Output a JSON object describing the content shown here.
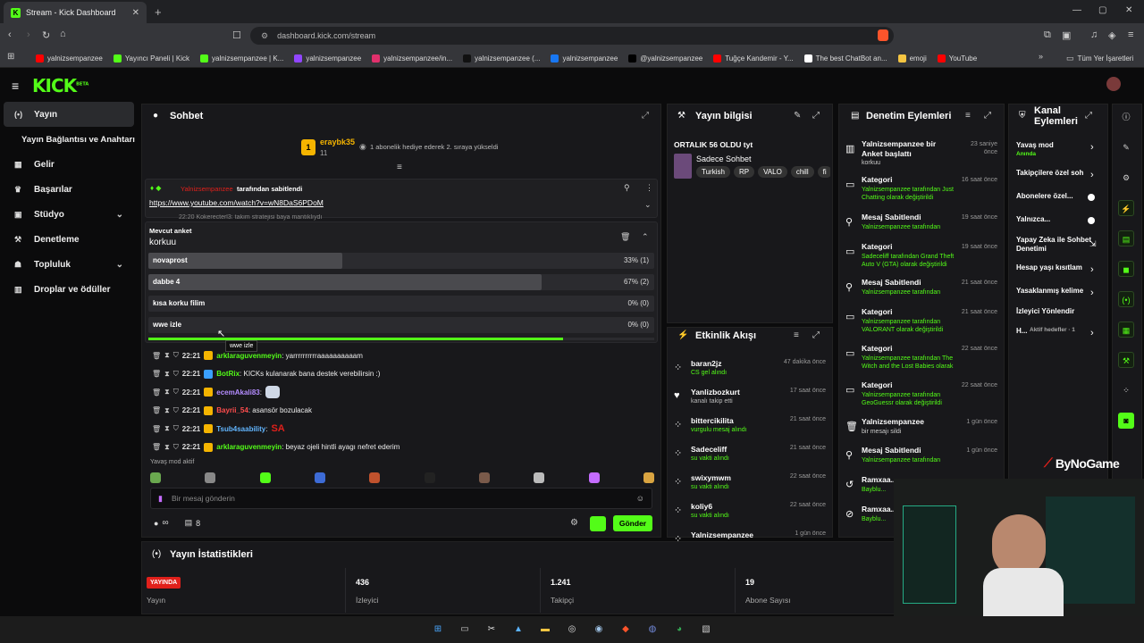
{
  "browser": {
    "tab_title": "Stream - Kick Dashboard",
    "url": "dashboard.kick.com/stream",
    "bookmarks": [
      {
        "label": "yalnizsempanzee",
        "color": "#ff0000"
      },
      {
        "label": "Yayıncı Paneli | Kick",
        "color": "#53fc18"
      },
      {
        "label": "yalnizsempanzee | K...",
        "color": "#53fc18"
      },
      {
        "label": "yalnizsempanzee",
        "color": "#9146ff"
      },
      {
        "label": "yalnizsempanzee/in...",
        "color": "#e1306c"
      },
      {
        "label": "yalnizsempanzee (...",
        "color": "#111111"
      },
      {
        "label": "yalnizsempanzee",
        "color": "#1877f2"
      },
      {
        "label": "@yalnizsempanzee",
        "color": "#000000"
      },
      {
        "label": "Tuğçe Kandemir - Y...",
        "color": "#ff0000"
      },
      {
        "label": "The best ChatBot an...",
        "color": "#ffffff"
      },
      {
        "label": "emoji",
        "color": "#f5c542"
      },
      {
        "label": "YouTube",
        "color": "#ff0000"
      }
    ],
    "all_bookmarks": "Tüm Yer İşaretleri"
  },
  "logo": "KICK",
  "logo_sup": "BETA",
  "sidebar": {
    "items": [
      {
        "label": "Yayın",
        "icon": "broadcast-icon"
      },
      {
        "label": "Yayın Bağlantısı ve Anahtarı",
        "icon": ""
      },
      {
        "label": "Gelir",
        "icon": "revenue-icon"
      },
      {
        "label": "Başarılar",
        "icon": "trophy-icon"
      },
      {
        "label": "Stüdyo",
        "icon": "studio-icon"
      },
      {
        "label": "Denetleme",
        "icon": "wrench-icon"
      },
      {
        "label": "Topluluk",
        "icon": "community-icon"
      },
      {
        "label": "Droplar ve ödüller",
        "icon": "drops-icon"
      }
    ]
  },
  "chat": {
    "title": "Sohbet",
    "gift": {
      "user": "eraybk35",
      "count": "11",
      "text": "1 abonelik hediye ederek 2. sıraya yükseldi"
    },
    "pinned": {
      "by_user": "Yalnizsempanzee",
      "by_text": "tarafından sabitlendi",
      "link": "https://www.youtube.com/watch?v=wN8DaS6PDoM"
    },
    "ghost_line": "22:20  Kokerecterl3: takım stratejisi baya mantıklıydı",
    "poll": {
      "label": "Mevcut anket",
      "question": "korkuu",
      "options": [
        {
          "label": "novaprost",
          "value": "33% (1)",
          "fraction": 0.33
        },
        {
          "label": "dabbe 4",
          "value": "67% (2)",
          "fraction": 0.67
        },
        {
          "label": "kısa korku filim",
          "value": "0% (0)",
          "fraction": 0
        },
        {
          "label": "wwe izle",
          "value": "0% (0)",
          "fraction": 0
        }
      ],
      "tooltip": "wwe izle",
      "progress": 0.82
    },
    "messages": [
      {
        "time": "22:21",
        "user": "arklaraguvenmeyin",
        "user_color": "#53fc18",
        "text": ": yarrrrrrrrrraaaaaaaaaam"
      },
      {
        "time": "22:21",
        "user": "BotRix",
        "user_color": "#53fc18",
        "text": ": KICKs kulanarak bana destek verebilirsin :)"
      },
      {
        "time": "22:21",
        "user": "ecemAkali83",
        "user_color": "#b48cff",
        "text": ":"
      },
      {
        "time": "22:21",
        "user": "Bayrii_54",
        "user_color": "#ff4d4d",
        "text": ": asansör bozulacak"
      },
      {
        "time": "22:21",
        "user": "Tsub4saability",
        "user_color": "#62b6ff",
        "text": ":"
      },
      {
        "time": "22:21",
        "user": "arklaraguvenmeyin",
        "user_color": "#53fc18",
        "text": ": beyaz ojeli hintli ayagı nefret ederim"
      }
    ],
    "tsub_emote": "SA",
    "slow_mode": "Yavaş mod aktif",
    "input_placeholder": "Bir mesaj gönderin",
    "viewer_icon_text": "∞",
    "gift_count": "8",
    "send": "Gönder"
  },
  "stream_info": {
    "title": "Yayın bilgisi",
    "stream_title": "ORTALIK 56 OLDU tyt",
    "category": "Sadece Sohbet",
    "tags": [
      "Turkish",
      "RP",
      "VALO",
      "chill",
      "fi"
    ]
  },
  "activity": {
    "title": "Etkinlik Akışı",
    "items": [
      {
        "user": "baran2jz",
        "sub": "CS gel alındı",
        "time": "47 dakika önce",
        "sub_green": true
      },
      {
        "user": "Yanlizbozkurt",
        "sub": "kanalı takip etti",
        "time": "17 saat önce",
        "sub_green": false
      },
      {
        "user": "bittercikilita",
        "sub": "vurgulu mesaj alındı",
        "time": "21 saat önce",
        "sub_green": true
      },
      {
        "user": "Sadeceliff",
        "sub": "su vakti alındı",
        "time": "21 saat önce",
        "sub_green": true
      },
      {
        "user": "swixymwm",
        "sub": "su vakti alındı",
        "time": "22 saat önce",
        "sub_green": true
      },
      {
        "user": "koliy6",
        "sub": "su vakti alındı",
        "time": "22 saat önce",
        "sub_green": true
      },
      {
        "user": "Yalnizsempanzee",
        "sub": "",
        "time": "1 gün önce",
        "sub_green": false
      }
    ]
  },
  "mod": {
    "title": "Denetim Eylemleri",
    "items": [
      {
        "icon": "poll-icon",
        "title": "Yalnizsempanzee bir Anket başlattı",
        "l2": "korkuu",
        "time": "23 saniye önce"
      },
      {
        "icon": "category-icon",
        "title": "Kategori",
        "l2": "Yalnizsempanzee tarafından Just Chatting olarak değiştirildi",
        "time": "16 saat önce"
      },
      {
        "icon": "pin-icon",
        "title": "Mesaj Sabitlendi",
        "l2": "Yalnizsempanzee tarafından",
        "time": "19 saat önce"
      },
      {
        "icon": "category-icon",
        "title": "Kategori",
        "l2": "Sadeceliff tarafından Grand Theft Auto V (GTA) olarak değiştirildi",
        "time": "19 saat önce"
      },
      {
        "icon": "pin-icon",
        "title": "Mesaj Sabitlendi",
        "l2": "Yalnizsempanzee tarafından",
        "time": "21 saat önce"
      },
      {
        "icon": "category-icon",
        "title": "Kategori",
        "l2": "Yalnizsempanzee tarafından VALORANT olarak değiştirildi",
        "time": "21 saat önce"
      },
      {
        "icon": "category-icon",
        "title": "Kategori",
        "l2": "Yalnizsempanzee tarafından The Witch and the Lost Babies olarak değiştirildi",
        "time": "22 saat önce"
      },
      {
        "icon": "category-icon",
        "title": "Kategori",
        "l2": "Yalnizsempanzee tarafından GeoGuessr olarak değiştirildi",
        "time": "22 saat önce"
      },
      {
        "icon": "trash-icon",
        "title": "Yalnizsempanzee",
        "l2": "bir mesajı sildi",
        "time": "1 gün önce"
      },
      {
        "icon": "pin-icon",
        "title": "Mesaj Sabitlendi",
        "l2": "Yalnizsempanzee tarafından",
        "time": "1 gün önce"
      },
      {
        "icon": "undo-icon",
        "title": "Ramxaa...",
        "l2": "Bayblu...",
        "time": ""
      },
      {
        "icon": "ban-icon",
        "title": "Ramxaa...",
        "l2": "Bayblu...",
        "time": ""
      }
    ]
  },
  "channel": {
    "title": "Kanal Eylemleri",
    "items": [
      {
        "label": "Yavaş mod",
        "sub": "Anında",
        "ctrl": "chevron"
      },
      {
        "label": "Takipçilere özel soh",
        "sub": "",
        "ctrl": "chevron"
      },
      {
        "label": "Abonelere özel...",
        "sub": "",
        "ctrl": "toggle"
      },
      {
        "label": "Yalnızca...",
        "sub": "",
        "ctrl": "toggle"
      },
      {
        "label": "Yapay Zeka ile Sohbet Denetimi",
        "sub": "",
        "ctrl": "external"
      },
      {
        "label": "Hesap yaşı kısıtlam",
        "sub": "",
        "ctrl": "chevron"
      },
      {
        "label": "Yasaklanmış kelime",
        "sub": "",
        "ctrl": "chevron"
      },
      {
        "label": "İzleyici Yönlendir",
        "sub": "",
        "ctrl": "none"
      },
      {
        "label": "H...",
        "sub": "Aktif hedefler · 1",
        "ctrl": "chevron"
      }
    ]
  },
  "stats": {
    "title": "Yayın İstatistikleri",
    "live_badge": "YAYINDA",
    "cells": [
      {
        "value": "",
        "label": "Yayın"
      },
      {
        "value": "436",
        "label": "İzleyici"
      },
      {
        "value": "1.241",
        "label": "Takipçi"
      },
      {
        "value": "19",
        "label": "Abone Sayısı"
      }
    ]
  },
  "watermark": "ByNoGame",
  "colors": {
    "accent": "#53fc18",
    "panel": "#18181b",
    "live": "#e0201b"
  }
}
